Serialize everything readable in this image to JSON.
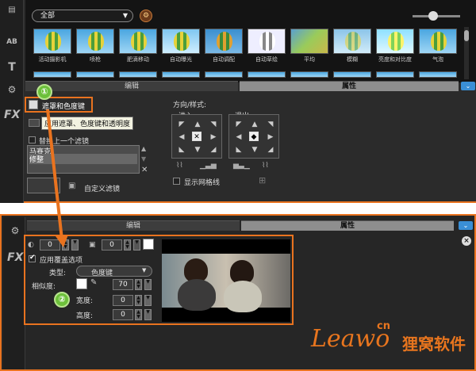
{
  "colors": {
    "accent": "#e9731f",
    "collapse": "#3a8fd6",
    "badge": "#6cc03a"
  },
  "toolbar_icons": [
    "clip-icon",
    "ab-title-icon",
    "t-text-icon",
    "transition-icon",
    "fx-icon"
  ],
  "fx_label": "FX",
  "text_label": "T",
  "ab_label": "AB",
  "category_dropdown": {
    "value": "全部"
  },
  "thumbnails": {
    "labels": [
      "活动摄影机",
      "喷枪",
      "肥滴移动",
      "自动曝光",
      "自动调配",
      "自动草绘",
      "平均",
      "模糊",
      "亮度和对比度",
      "气泡"
    ]
  },
  "tabs": {
    "edit": "编辑",
    "properties": "属性"
  },
  "collapse_icon": "⌄",
  "badges": {
    "one": "①",
    "two": "②"
  },
  "mask": {
    "button_label": "遮罩和色度键",
    "tooltip": "应用遮罩、色度键和透明度",
    "replace_last_filter": "替换上一个滤镜",
    "filter_list": [
      "马赛克",
      "修整"
    ],
    "custom_filter": "自定义滤镜"
  },
  "direction": {
    "title": "方向/样式:",
    "enter": "进入",
    "exit": "退出",
    "show_grid": "显示网格线"
  },
  "bottom": {
    "opacity_value": "0",
    "border_value": "0",
    "apply_overlay": "应用覆盖选项",
    "type_label": "类型:",
    "type_value": "色度键",
    "similarity_label": "相似度:",
    "similarity_value": "70",
    "width_label": "宽度:",
    "width_value": "0",
    "height_label": "高度:",
    "height_value": "0",
    "close": "×"
  },
  "logo": {
    "main": "Leawo",
    "cn": "cn",
    "chinese": "狸窝软件"
  }
}
